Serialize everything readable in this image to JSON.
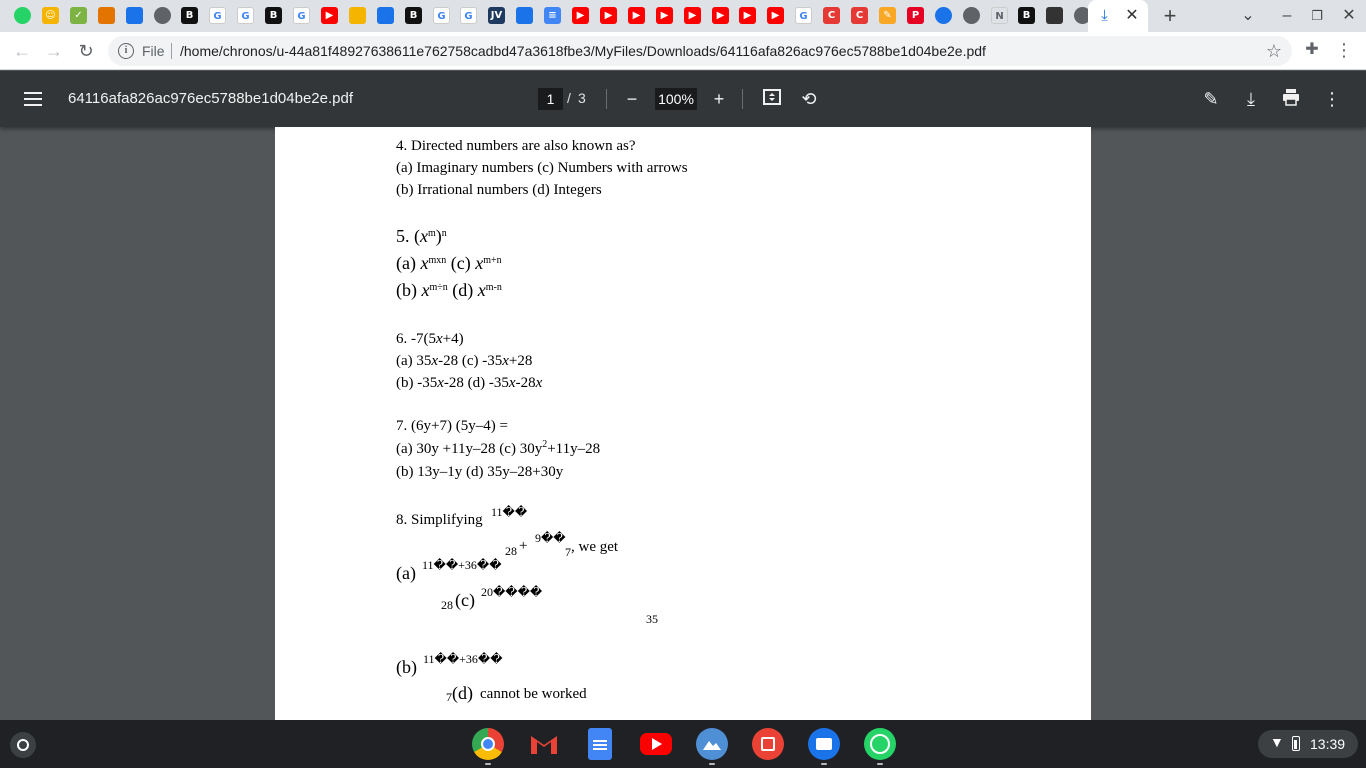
{
  "browser": {
    "tabs": [
      {
        "icon": "whatsapp-icon",
        "glyph": "",
        "color": "#25d366"
      },
      {
        "icon": "emoji-icon",
        "glyph": "☺",
        "color": "#f4b400"
      },
      {
        "icon": "check-icon",
        "glyph": "✓",
        "color": "#7cb342"
      },
      {
        "icon": "profile-icon",
        "glyph": "",
        "color": "#e37400"
      },
      {
        "icon": "profile-icon",
        "glyph": "",
        "color": "#1a73e8"
      },
      {
        "icon": "globe-icon",
        "glyph": "",
        "color": "#5f6368"
      },
      {
        "icon": "b-icon",
        "glyph": "B",
        "color": "#111111"
      },
      {
        "icon": "google-icon",
        "glyph": "G",
        "color": "#ffffff"
      },
      {
        "icon": "google-icon",
        "glyph": "G",
        "color": "#ffffff"
      },
      {
        "icon": "b-icon",
        "glyph": "B",
        "color": "#111111"
      },
      {
        "icon": "google-icon",
        "glyph": "G",
        "color": "#ffffff"
      },
      {
        "icon": "youtube-icon",
        "glyph": "▶",
        "color": "#ff0000"
      },
      {
        "icon": "profile-icon",
        "glyph": "",
        "color": "#f4b400"
      },
      {
        "icon": "profile-icon",
        "glyph": "",
        "color": "#1a73e8"
      },
      {
        "icon": "b-icon",
        "glyph": "B",
        "color": "#111111"
      },
      {
        "icon": "google-icon",
        "glyph": "G",
        "color": "#ffffff"
      },
      {
        "icon": "google-icon",
        "glyph": "G",
        "color": "#ffffff"
      },
      {
        "icon": "jv-icon",
        "glyph": "JV",
        "color": "#1e3a5f"
      },
      {
        "icon": "image-icon",
        "glyph": "",
        "color": "#1a73e8"
      },
      {
        "icon": "doc-icon",
        "glyph": "≡",
        "color": "#4285f4"
      },
      {
        "icon": "youtube-icon",
        "glyph": "▶",
        "color": "#ff0000"
      },
      {
        "icon": "youtube-icon",
        "glyph": "▶",
        "color": "#ff0000"
      },
      {
        "icon": "youtube-icon",
        "glyph": "▶",
        "color": "#ff0000"
      },
      {
        "icon": "youtube-icon",
        "glyph": "▶",
        "color": "#ff0000"
      },
      {
        "icon": "youtube-icon",
        "glyph": "▶",
        "color": "#ff0000"
      },
      {
        "icon": "youtube-icon",
        "glyph": "▶",
        "color": "#ff0000"
      },
      {
        "icon": "youtube-icon",
        "glyph": "▶",
        "color": "#ff0000"
      },
      {
        "icon": "youtube-icon",
        "glyph": "▶",
        "color": "#ff0000"
      },
      {
        "icon": "google-icon",
        "glyph": "G",
        "color": "#ffffff"
      },
      {
        "icon": "c-icon",
        "glyph": "C",
        "color": "#e53935"
      },
      {
        "icon": "c-icon",
        "glyph": "C",
        "color": "#e53935"
      },
      {
        "icon": "pencil-icon",
        "glyph": "✎",
        "color": "#f9a825"
      },
      {
        "icon": "pinterest-icon",
        "glyph": "P",
        "color": "#e60023"
      },
      {
        "icon": "compass-icon",
        "glyph": "",
        "color": "#1a73e8"
      },
      {
        "icon": "globe-icon",
        "glyph": "",
        "color": "#5f6368"
      },
      {
        "icon": "n-icon",
        "glyph": "N",
        "color": "#dee1e6"
      },
      {
        "icon": "b-icon",
        "glyph": "B",
        "color": "#111111"
      },
      {
        "icon": "image-icon",
        "glyph": "",
        "color": "#333333"
      },
      {
        "icon": "globe-icon",
        "glyph": "",
        "color": "#5f6368"
      },
      {
        "icon": "youtube-icon",
        "glyph": "▶",
        "color": "#ff0000"
      }
    ],
    "active_tab_icon": "download-icon",
    "address": {
      "scheme_label": "File",
      "url": "/home/chronos/u-44a81f48927638611e762758cadbd47a3618fbe3/MyFiles/Downloads/64116afa826ac976ec5788be1d04be2e.pdf"
    }
  },
  "pdf_viewer": {
    "title": "64116afa826ac976ec5788be1d04be2e.pdf",
    "page_current": "1",
    "page_separator": "/",
    "page_total": "3",
    "zoom": "100%"
  },
  "document": {
    "q4": {
      "q": "4. Directed numbers are also known as?",
      "a": "(a) Imaginary numbers (c) Numbers with arrows",
      "b": "(b) Irrational numbers (d) Integers"
    },
    "q5": {
      "num": "5. (",
      "x": "x",
      "m": "m",
      "close": ")",
      "n": "n",
      "a_pre": "(a) ",
      "a_exp1": "mxn",
      "a_mid": " (c) ",
      "a_exp2": "m+n",
      "b_pre": "(b) ",
      "b_exp1": "m÷n",
      "b_mid": " (d) ",
      "b_exp2": "m-n"
    },
    "q6": {
      "q_pre": "6. -7(5",
      "q_post": "+4)",
      "a1": "(a) 35",
      "a2": "-28 (c) -35",
      "a3": "+28",
      "b1": "(b) -35",
      "b2": "-28 (d) -35",
      "b3": "-28"
    },
    "q7": {
      "q": "7. (6y+7) (5y–4) =",
      "a_pre": "(a) 30y +11y–28 (c) 30y",
      "a_sup": "2",
      "a_post": "+11y–28",
      "b": "(b) 13y–1y (d) 35y–28+30y"
    },
    "q8": {
      "label": "8. Simplifying",
      "frac1": "11��",
      "d28": "28",
      "plus": "+",
      "frac2": "9��",
      "d7": "7",
      "tail": ", we get",
      "a_label": "(a)",
      "a_num": "11��+36��",
      "d28b": "28",
      "c_label": "(c)",
      "c_num": "20����",
      "d35": "35",
      "b_label": "(b)",
      "b_num": "11��+36��",
      "d7b": "7",
      "d_label": "(d)",
      "d_text": "cannot be worked"
    }
  },
  "shelf": {
    "apps": [
      {
        "name": "chrome-app-icon",
        "color": "#4285f4"
      },
      {
        "name": "gmail-app-icon",
        "color": "#ffffff"
      },
      {
        "name": "docs-app-icon",
        "color": "#4285f4"
      },
      {
        "name": "youtube-app-icon",
        "color": "#ff0000"
      },
      {
        "name": "photos-app-icon",
        "color": "#4f8fd6"
      },
      {
        "name": "gallery-app-icon",
        "color": "#ea4335"
      },
      {
        "name": "files-app-icon",
        "color": "#1a73e8"
      },
      {
        "name": "whatsapp-app-icon",
        "color": "#25d366"
      }
    ],
    "clock": "13:39"
  }
}
